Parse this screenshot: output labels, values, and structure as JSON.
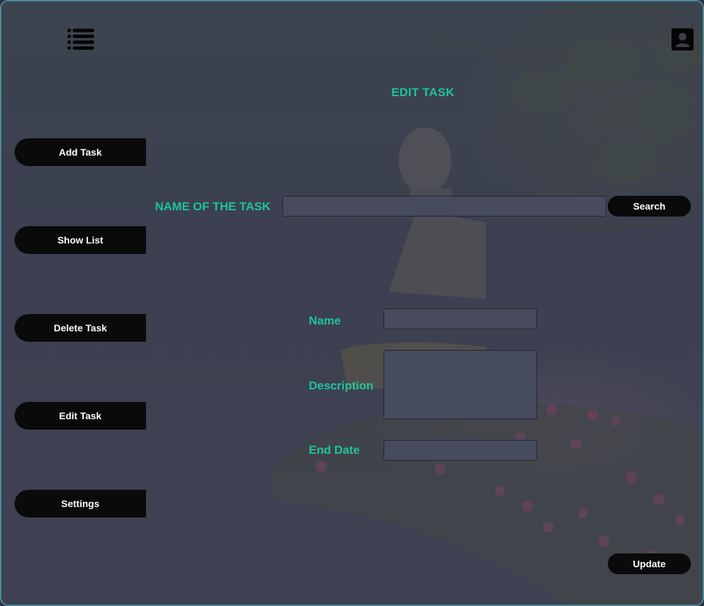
{
  "header": {
    "menu_icon": "list-icon",
    "profile_icon": "user-icon"
  },
  "page": {
    "title": "EDIT TASK"
  },
  "sidebar": {
    "items": [
      {
        "label": "Add Task"
      },
      {
        "label": "Show List"
      },
      {
        "label": "Delete Task"
      },
      {
        "label": "Edit Task"
      },
      {
        "label": "Settings"
      }
    ]
  },
  "search": {
    "label": "NAME OF THE TASK",
    "value": "",
    "button_label": "Search"
  },
  "form": {
    "name_label": "Name",
    "name_value": "",
    "description_label": "Description",
    "description_value": "",
    "end_date_label": "End Date",
    "end_date_value": "",
    "update_label": "Update"
  },
  "colors": {
    "accent": "#1fc39a",
    "button_bg": "#0a0a0a",
    "input_bg": "#474b5e"
  }
}
